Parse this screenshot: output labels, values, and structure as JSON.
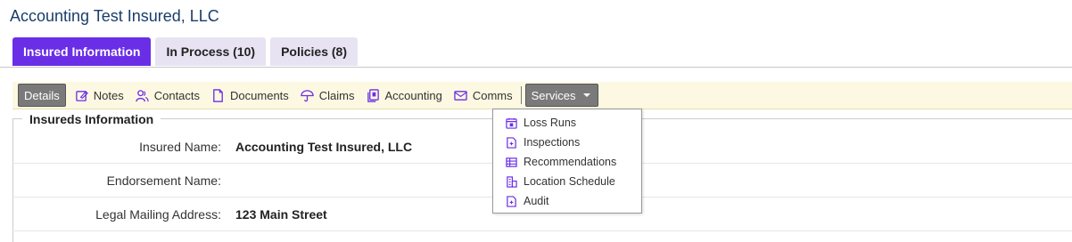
{
  "page_title": "Accounting Test Insured, LLC",
  "tabs": [
    {
      "label": "Insured Information"
    },
    {
      "label": "In Process (10)"
    },
    {
      "label": "Policies (8)"
    }
  ],
  "toolbar": {
    "details": "Details",
    "notes": "Notes",
    "contacts": "Contacts",
    "documents": "Documents",
    "claims": "Claims",
    "accounting": "Accounting",
    "comms": "Comms",
    "services": "Services"
  },
  "services_menu": [
    {
      "label": "Loss Runs",
      "icon": "calendar-icon"
    },
    {
      "label": "Inspections",
      "icon": "document-icon"
    },
    {
      "label": "Recommendations",
      "icon": "table-icon"
    },
    {
      "label": "Location Schedule",
      "icon": "building-icon"
    },
    {
      "label": "Audit",
      "icon": "document-icon"
    }
  ],
  "section": {
    "legend": "Insureds Information",
    "fields": [
      {
        "label": "Insured Name:",
        "value": "Accounting Test Insured, LLC"
      },
      {
        "label": "Endorsement Name:",
        "value": ""
      },
      {
        "label": "Legal Mailing Address:",
        "value": "123 Main Street"
      }
    ]
  },
  "colors": {
    "accent": "#6a2ee6",
    "tab_inactive": "#e7e3f3",
    "toolbar_bg": "#fcf8e1",
    "title": "#1a3d6b"
  }
}
